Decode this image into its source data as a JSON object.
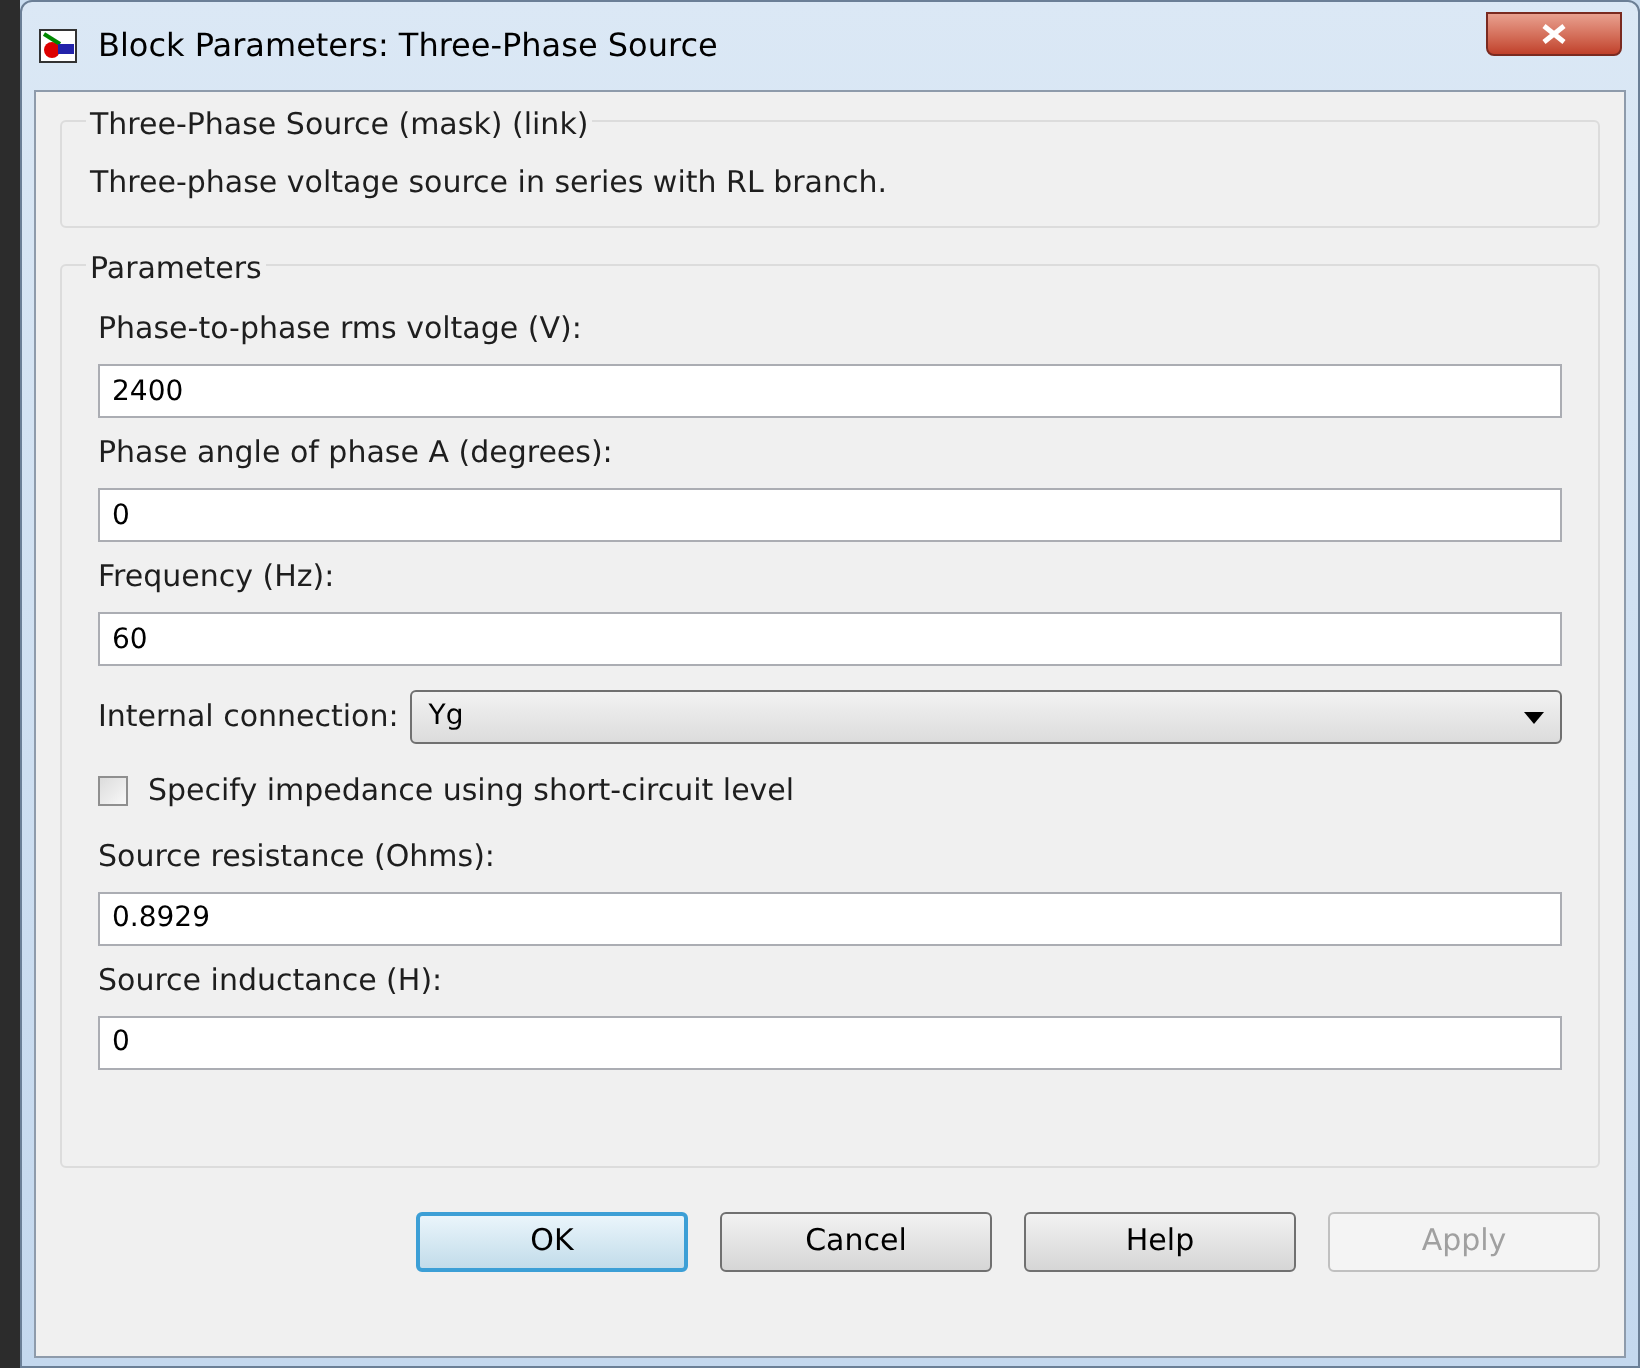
{
  "window": {
    "title": "Block Parameters: Three-Phase Source"
  },
  "description": {
    "title": "Three-Phase Source (mask) (link)",
    "text": "Three-phase voltage source in series with RL branch."
  },
  "parameters": {
    "title": "Parameters",
    "items": [
      {
        "kind": "text",
        "label": "Phase-to-phase rms voltage (V):",
        "value": "2400"
      },
      {
        "kind": "text",
        "label": "Phase angle of phase A (degrees):",
        "value": "0"
      },
      {
        "kind": "text",
        "label": "Frequency (Hz):",
        "value": "60"
      },
      {
        "kind": "dropdown",
        "label": "Internal connection:",
        "value": "Yg"
      },
      {
        "kind": "checkbox",
        "label": "Specify impedance using short-circuit level",
        "checked": false
      },
      {
        "kind": "text",
        "label": "Source resistance (Ohms):",
        "value": "0.8929"
      },
      {
        "kind": "text",
        "label": "Source inductance (H):",
        "value": "0"
      }
    ]
  },
  "buttons": [
    {
      "label": "OK",
      "default": true,
      "disabled": false
    },
    {
      "label": "Cancel",
      "default": false,
      "disabled": false
    },
    {
      "label": "Help",
      "default": false,
      "disabled": false
    },
    {
      "label": "Apply",
      "default": false,
      "disabled": true
    }
  ]
}
